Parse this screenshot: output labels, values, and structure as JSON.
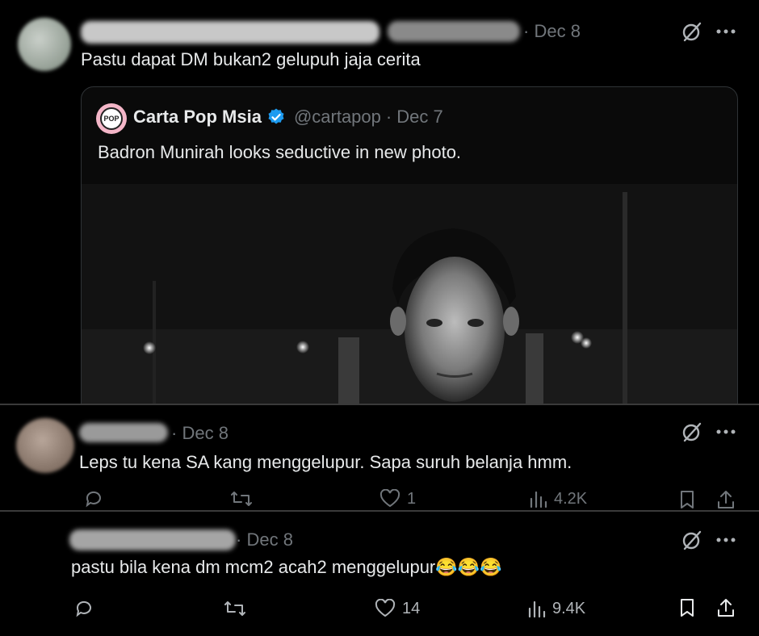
{
  "tweet1": {
    "date": "Dec 8",
    "text": "Pastu dapat DM bukan2 gelupuh jaja cerita",
    "quote": {
      "name": "Carta Pop Msia",
      "handle": "@cartapop",
      "date": "Dec 7",
      "text": "Badron Munirah looks seductive in new photo.",
      "avatar_label": "POP"
    }
  },
  "tweet2": {
    "date": "Dec 8",
    "text": "Leps tu kena SA kang menggelupur. Sapa suruh belanja hmm.",
    "likes": "1",
    "views": "4.2K"
  },
  "tweet3": {
    "date": "Dec 8",
    "text": "pastu bila kena dm mcm2 acah2 menggelupur",
    "emoji": "😂😂😂",
    "likes": "14",
    "views": "9.4K"
  },
  "colors": {
    "background": "#000000",
    "text": "#e7e9ea",
    "muted": "#71767b",
    "verified": "#1d9bf0",
    "pop_badge": "#f4b6c8"
  },
  "icons": [
    "grok-icon",
    "more-icon",
    "reply-icon",
    "retweet-icon",
    "like-icon",
    "views-icon",
    "bookmark-icon",
    "share-icon",
    "verified-badge-icon"
  ]
}
